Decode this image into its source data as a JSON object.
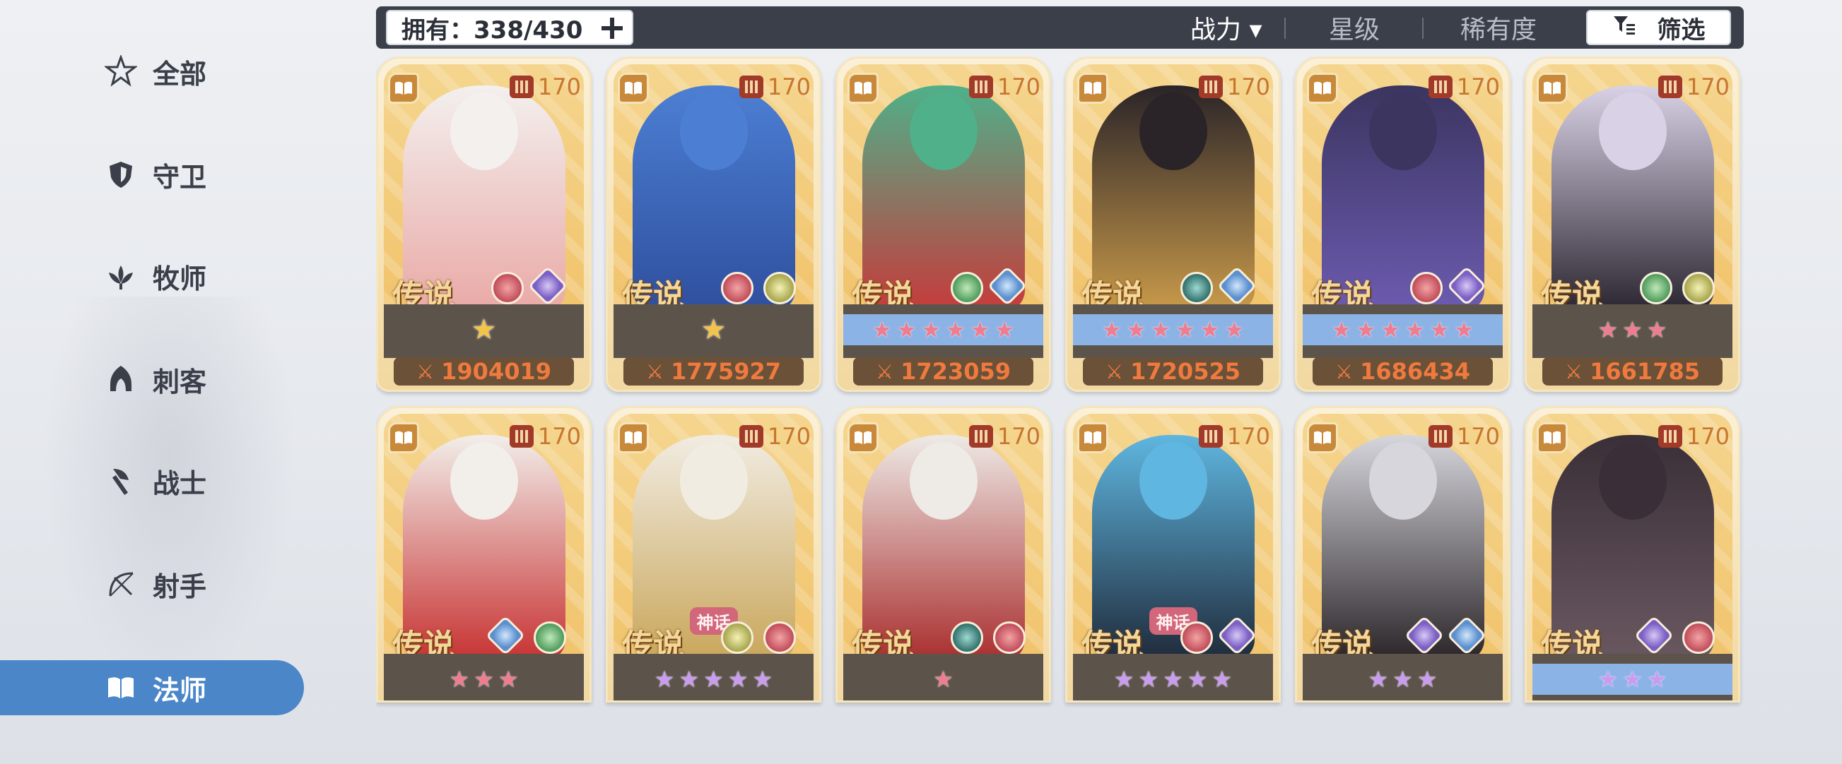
{
  "sidebar": {
    "items": [
      {
        "label": "全部",
        "icon": "star-outline-icon",
        "active": false
      },
      {
        "label": "守卫",
        "icon": "shield-icon",
        "active": false
      },
      {
        "label": "牧师",
        "icon": "lotus-icon",
        "active": false
      },
      {
        "label": "刺客",
        "icon": "hood-icon",
        "active": false
      },
      {
        "label": "战士",
        "icon": "axe-icon",
        "active": false
      },
      {
        "label": "射手",
        "icon": "bow-icon",
        "active": false
      },
      {
        "label": "法师",
        "icon": "book-icon",
        "active": true
      }
    ]
  },
  "topbar": {
    "owned_label": "拥有：338/430",
    "sort_tabs": [
      {
        "label": "战力 ▾",
        "active": true
      },
      {
        "label": "星级",
        "active": false
      },
      {
        "label": "稀有度",
        "active": false
      }
    ],
    "filter_label": "筛选"
  },
  "colors": {
    "active_tab": "#4a86c8",
    "topbar_bg": "#3b3f49",
    "power_text": "#f07a3e",
    "level_text": "#c7762e"
  },
  "cards_row1": [
    {
      "level": "170",
      "rarity_label": "传说",
      "elements": [
        "fire",
        "water"
      ],
      "stars": "wings",
      "power": "1904019",
      "palette": [
        "#f3f0ee",
        "#e9a9a6"
      ]
    },
    {
      "level": "170",
      "rarity_label": "传说",
      "elements": [
        "fire",
        "light"
      ],
      "stars": "wings",
      "power": "1775927",
      "palette": [
        "#4c7fd3",
        "#2f4f9e"
      ]
    },
    {
      "level": "170",
      "rarity_label": "传说",
      "elements": [
        "wind",
        "ice"
      ],
      "stars": "6-pink-blue",
      "power": "1723059",
      "palette": [
        "#4fb08a",
        "#c63b3b"
      ]
    },
    {
      "level": "170",
      "rarity_label": "传说",
      "elements": [
        "void",
        "ice"
      ],
      "stars": "6-pink-blue",
      "power": "1720525",
      "palette": [
        "#2a2428",
        "#c99a4a"
      ]
    },
    {
      "level": "170",
      "rarity_label": "传说",
      "elements": [
        "fire",
        "water"
      ],
      "stars": "6-pink-blue",
      "power": "1686434",
      "palette": [
        "#3b3560",
        "#6c5bb0"
      ]
    },
    {
      "level": "170",
      "rarity_label": "传说",
      "elements": [
        "wind",
        "light"
      ],
      "stars": "3-pink",
      "power": "1661785",
      "palette": [
        "#d9d2e6",
        "#2a2530"
      ]
    }
  ],
  "cards_row2": [
    {
      "level": "170",
      "rarity_label": "传说",
      "elements": [
        "ice",
        "wind"
      ],
      "stars": "3-pink",
      "badge": "",
      "palette": [
        "#f2eeea",
        "#c73232"
      ]
    },
    {
      "level": "170",
      "rarity_label": "传说",
      "elements": [
        "light",
        "fire"
      ],
      "stars": "5-purple",
      "badge": "神话",
      "palette": [
        "#f1ece2",
        "#c9a65a"
      ]
    },
    {
      "level": "170",
      "rarity_label": "传说",
      "elements": [
        "void",
        "fire"
      ],
      "stars": "1-pink",
      "badge": "",
      "palette": [
        "#eeeae6",
        "#a92e2e"
      ]
    },
    {
      "level": "170",
      "rarity_label": "传说",
      "elements": [
        "fire",
        "water"
      ],
      "stars": "5-purple",
      "badge": "神话",
      "palette": [
        "#5fb6e0",
        "#1f2a3a"
      ]
    },
    {
      "level": "170",
      "rarity_label": "传说",
      "elements": [
        "water",
        "ice"
      ],
      "stars": "3-purple",
      "badge": "",
      "palette": [
        "#d6d6dc",
        "#2a2428"
      ]
    },
    {
      "level": "170",
      "rarity_label": "传说",
      "elements": [
        "water",
        "fire"
      ],
      "stars": "3-purple-blue",
      "badge": "",
      "palette": [
        "#3a2f38",
        "#6a5860"
      ]
    }
  ]
}
